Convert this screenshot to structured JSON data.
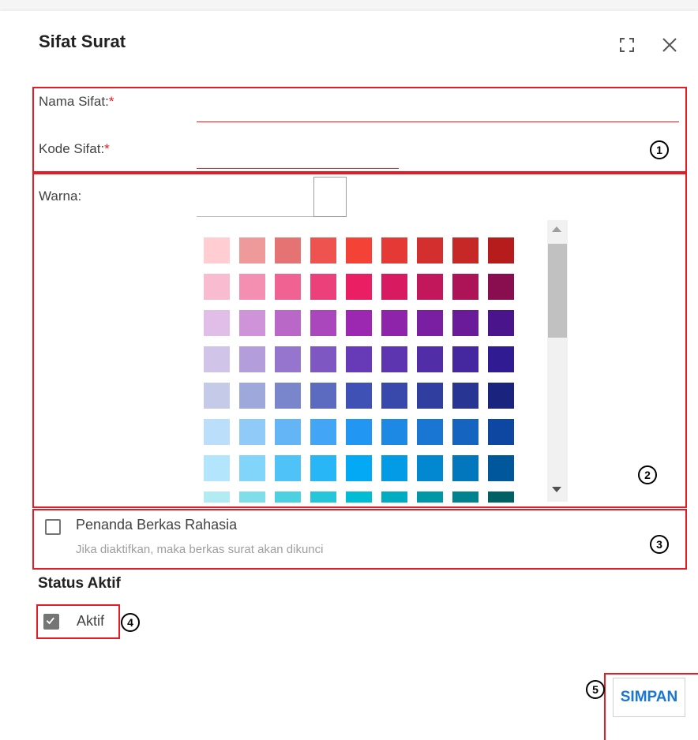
{
  "dialog": {
    "title": "Sifat Surat",
    "fullscreen_icon": "fullscreen-icon",
    "close_icon": "close-icon"
  },
  "form": {
    "nama_label": "Nama Sifat:",
    "nama_value": "",
    "kode_label": "Kode Sifat:",
    "kode_value": "",
    "required_mark": "*",
    "warna_label": "Warna:",
    "selected_color": "#ffffff"
  },
  "palette": {
    "rows": [
      [
        "#ffcdd2",
        "#ef9a9a",
        "#e57373",
        "#ef5350",
        "#f44336",
        "#e53935",
        "#d32f2f",
        "#c62828",
        "#b71c1c"
      ],
      [
        "#f8bbd0",
        "#f48fb1",
        "#f06292",
        "#ec407a",
        "#e91e63",
        "#d81b60",
        "#c2185b",
        "#ad1457",
        "#880e4f"
      ],
      [
        "#e1bee7",
        "#ce93d8",
        "#ba68c8",
        "#ab47bc",
        "#9c27b0",
        "#8e24aa",
        "#7b1fa2",
        "#6a1b9a",
        "#4a148c"
      ],
      [
        "#d1c4e9",
        "#b39ddb",
        "#9575cd",
        "#7e57c2",
        "#673ab7",
        "#5e35b1",
        "#512da8",
        "#4527a0",
        "#311b92"
      ],
      [
        "#c5cae9",
        "#9fa8da",
        "#7986cb",
        "#5c6bc0",
        "#3f51b5",
        "#3949ab",
        "#303f9f",
        "#283593",
        "#1a237e"
      ],
      [
        "#bbdefb",
        "#90caf9",
        "#64b5f6",
        "#42a5f5",
        "#2196f3",
        "#1e88e5",
        "#1976d2",
        "#1565c0",
        "#0d47a1"
      ],
      [
        "#b3e5fc",
        "#81d4fa",
        "#4fc3f7",
        "#29b6f6",
        "#03a9f4",
        "#039be5",
        "#0288d1",
        "#0277bd",
        "#01579b"
      ],
      [
        "#b2ebf2",
        "#80deea",
        "#4dd0e1",
        "#26c6da",
        "#00bcd4",
        "#00acc1",
        "#0097a7",
        "#00838f",
        "#006064"
      ]
    ]
  },
  "confidential": {
    "label": "Penanda Berkas Rahasia",
    "hint": "Jika diaktifkan, maka berkas surat akan dikunci",
    "checked": false
  },
  "status": {
    "title": "Status Aktif",
    "label": "Aktif",
    "checked": true
  },
  "actions": {
    "save_label": "SIMPAN"
  },
  "annotations": [
    "1",
    "2",
    "3",
    "4",
    "5"
  ],
  "colors": {
    "annotation": "#e51c23",
    "accent": "#1976d2",
    "checkbox": "#757575"
  }
}
